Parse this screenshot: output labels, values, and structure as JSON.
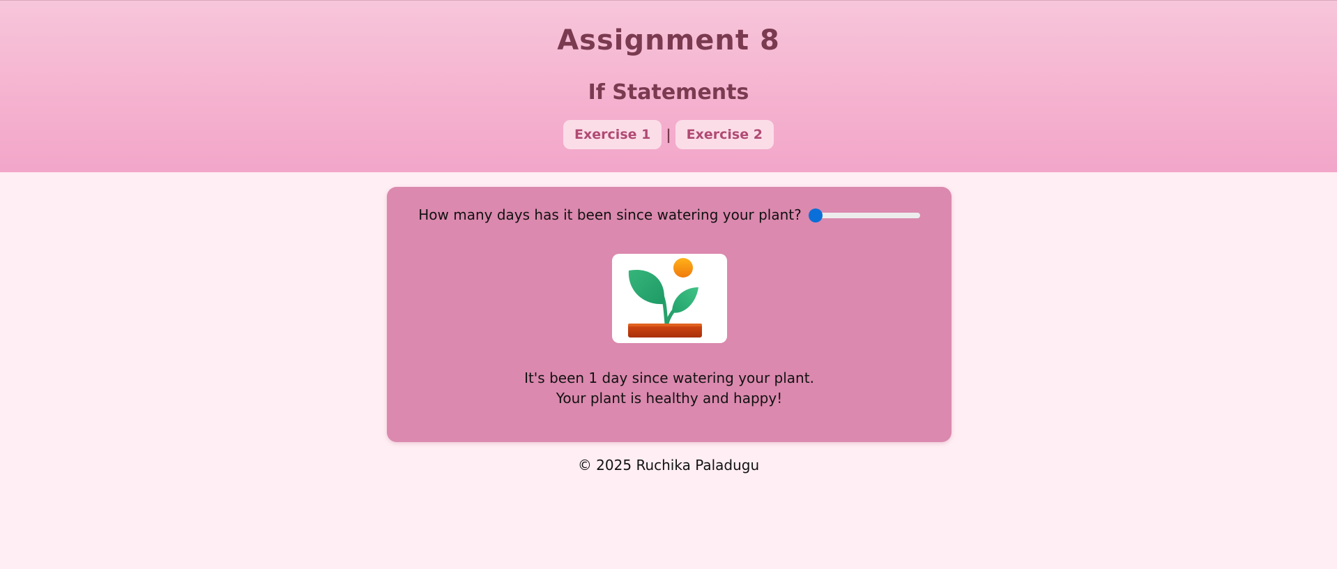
{
  "header": {
    "title": "Assignment 8",
    "subtitle": "If Statements",
    "nav": [
      {
        "label": "Exercise 1"
      },
      {
        "label": "Exercise 2"
      }
    ],
    "separator": "|"
  },
  "main": {
    "question": "How many days has it been since watering your plant?",
    "slider": {
      "value": 1,
      "min": 1,
      "max": 10
    },
    "plant_image": "healthy-plant-icon",
    "result_line1": "It's been 1 day since watering your plant.",
    "result_line2": "Your plant is healthy and happy!"
  },
  "footer": {
    "text": "© 2025 Ruchika Paladugu"
  },
  "colors": {
    "header_top": "#f7c6da",
    "header_bottom": "#f2a6c9",
    "page_bg": "#ffeef3",
    "card_bg": "#db89ae",
    "title_color": "#7a3a4f",
    "nav_text": "#b04a72",
    "slider_thumb": "#0a6fd8"
  }
}
